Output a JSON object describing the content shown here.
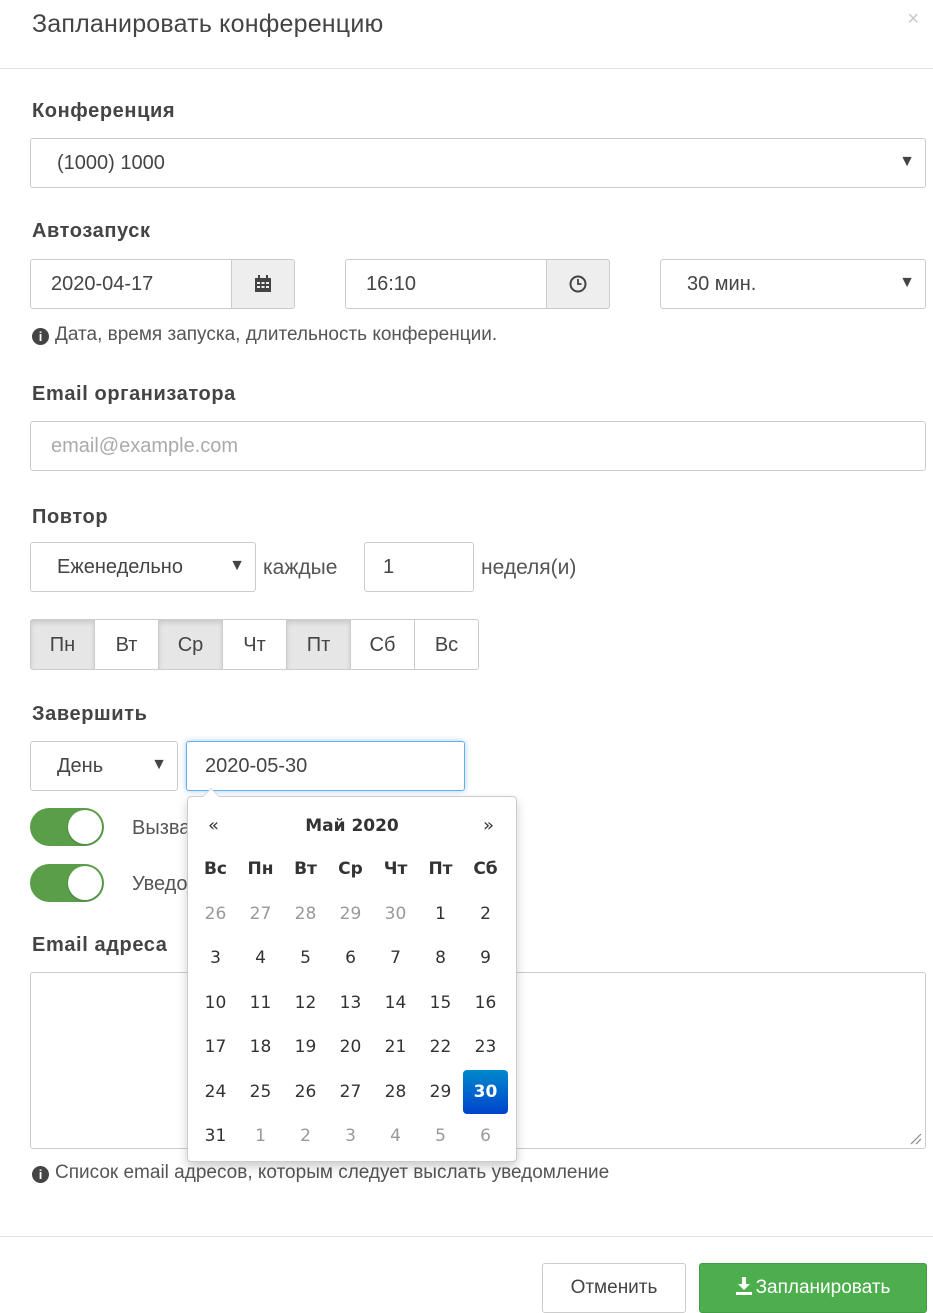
{
  "modal": {
    "title": "Запланировать конференцию",
    "close_glyph": "×"
  },
  "conference": {
    "label": "Конференция",
    "selected": "(1000) 1000"
  },
  "autostart": {
    "label": "Автозапуск",
    "date": "2020-04-17",
    "time": "16:10",
    "duration": "30 мин.",
    "help": "Дата, время запуска, длительность конференции."
  },
  "organizer_email": {
    "label": "Email организатора",
    "placeholder": "email@example.com",
    "value": ""
  },
  "repeat": {
    "label": "Повтор",
    "frequency": "Еженедельно",
    "every_label": "каждые",
    "interval": "1",
    "unit_label": "неделя(и)",
    "days": [
      {
        "label": "Пн",
        "active": true
      },
      {
        "label": "Вт",
        "active": false
      },
      {
        "label": "Ср",
        "active": true
      },
      {
        "label": "Чт",
        "active": false
      },
      {
        "label": "Пт",
        "active": true
      },
      {
        "label": "Сб",
        "active": false
      },
      {
        "label": "Вс",
        "active": false
      }
    ]
  },
  "finish": {
    "label": "Завершить",
    "mode": "День",
    "date": "2020-05-30"
  },
  "toggles": [
    {
      "label": "Вызвать",
      "on": true
    },
    {
      "label": "Уведомить",
      "on": true
    }
  ],
  "email_addresses": {
    "label": "Email адреса",
    "help": "Список email адресов, которым следует выслать уведомление"
  },
  "buttons": {
    "cancel": "Отменить",
    "submit": "Запланировать"
  },
  "datepicker": {
    "prev": "«",
    "next": "»",
    "title": "Май 2020",
    "weekdays": [
      "Вс",
      "Пн",
      "Вт",
      "Ср",
      "Чт",
      "Пт",
      "Сб"
    ],
    "weeks": [
      [
        "26",
        "27",
        "28",
        "29",
        "30",
        "1",
        "2"
      ],
      [
        "3",
        "4",
        "5",
        "6",
        "7",
        "8",
        "9"
      ],
      [
        "10",
        "11",
        "12",
        "13",
        "14",
        "15",
        "16"
      ],
      [
        "17",
        "18",
        "19",
        "20",
        "21",
        "22",
        "23"
      ],
      [
        "24",
        "25",
        "26",
        "27",
        "28",
        "29",
        "30"
      ],
      [
        "31",
        "1",
        "2",
        "3",
        "4",
        "5",
        "6"
      ]
    ],
    "selected": "30"
  },
  "colors": {
    "success": "#4cae4c",
    "toggle_on": "#5a9e4a",
    "selected_day": "#0055cc"
  }
}
